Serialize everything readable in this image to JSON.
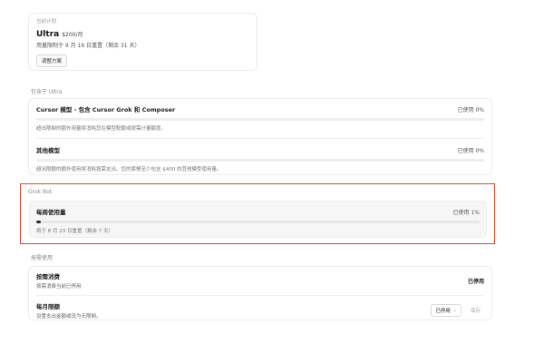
{
  "plan": {
    "kicker": "当前计划",
    "name": "Ultra",
    "price": "$200/月",
    "reset_text": "用量限制于 9 月 16 日重置（剩余 31 天）",
    "adjust_button": "调整方案"
  },
  "included": {
    "section_label": "包含于 Ultra",
    "items": [
      {
        "title": "Cursor 模型 - 包含 Cursor Grok 和 Composer",
        "used": "已使用 0%",
        "progress": 0,
        "note": "超出限制的额外用量将消耗您在模型配额或按需计量额度。"
      },
      {
        "title": "其他模型",
        "used": "已使用 0%",
        "progress": 0,
        "note": "超出限额的额外使用将消耗按需支出。您的套餐至少包含 $400 的其他模型使用量。"
      }
    ]
  },
  "grok": {
    "section_label": "Grok Bot",
    "title": "每周使用量",
    "used": "已使用 1%",
    "progress": 0.01,
    "reset_text": "将于 8 月 23 日重置（剩余 7 天）"
  },
  "ondemand": {
    "section_label": "按需使用",
    "spend": {
      "title": "按需消费",
      "sub": "按需消费当前已停用",
      "status": "已停用"
    },
    "limit": {
      "title": "每月限额",
      "sub": "设置支出金额或设为无限制。",
      "select_value": "已停用",
      "save_label": "保存"
    }
  },
  "colors": {
    "highlight_border": "#d9482a",
    "bar_fill": "#2a2a2a"
  },
  "icons": {
    "select_chevron": "chevron-down-icon"
  }
}
